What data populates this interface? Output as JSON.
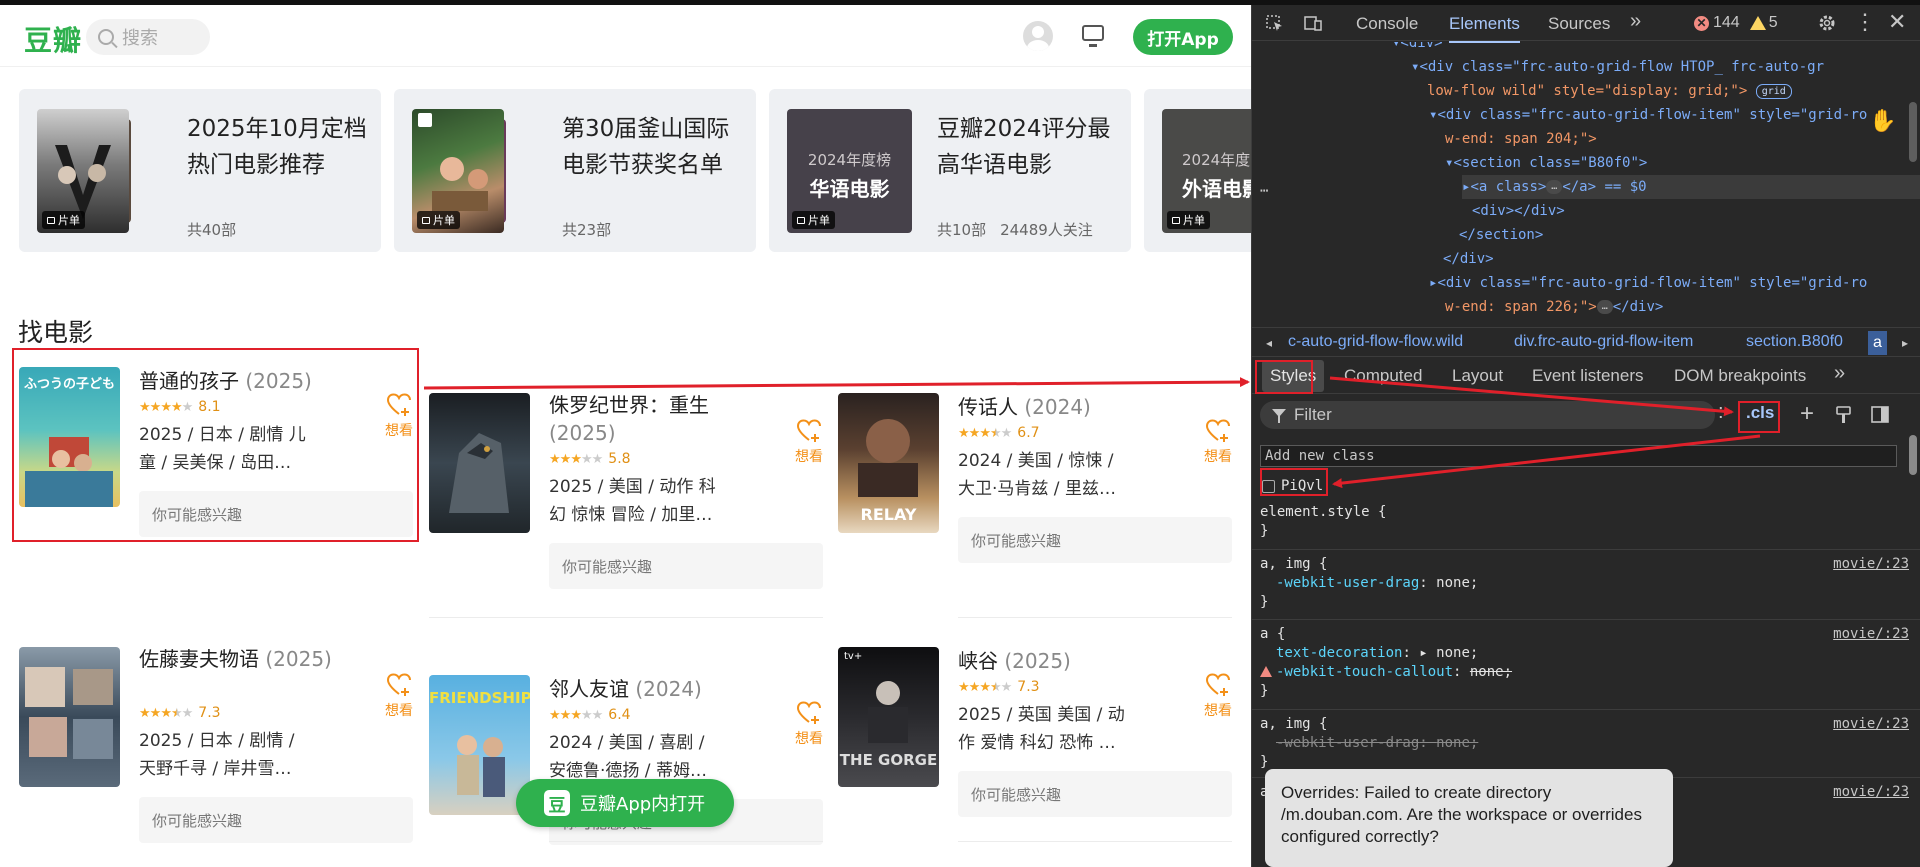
{
  "page": {
    "logo": "豆瓣",
    "search_placeholder": "搜索",
    "open_app": "打开App",
    "section_title": "找电影",
    "float_button": "豆瓣App内打开",
    "float_logo": "豆"
  },
  "doulists": [
    {
      "title": "2025年10月定档热门电影推荐",
      "count": "共40部",
      "followers": "",
      "tag": "片单",
      "cover_title": "",
      "cover_sub": ""
    },
    {
      "title": "第30届釜山国际电影节获奖名单",
      "count": "共23部",
      "followers": "",
      "tag": "片单",
      "cover_title": "",
      "cover_sub": ""
    },
    {
      "title": "豆瓣2024评分最高华语电影",
      "count": "共10部",
      "followers": "24489人关注",
      "tag": "片单",
      "cover_title": "华语电影",
      "cover_sub": "2024年度榜"
    },
    {
      "title": "",
      "count": "",
      "followers": "",
      "tag": "片单",
      "cover_title": "外语电影",
      "cover_sub": "2024年度"
    }
  ],
  "movies": [
    {
      "title": "普通的孩子",
      "year": "(2025)",
      "rating": "8.1",
      "stars": 4,
      "line1": "2025 / 日本 / 剧情 儿",
      "line2": "童 / 吴美保 / 岛田…",
      "maybe": "你可能感兴趣",
      "want": "想看"
    },
    {
      "title": "侏罗纪世界：重生",
      "year": "(2025)",
      "rating": "5.8",
      "stars": 3,
      "line1": "2025 / 美国 / 动作 科",
      "line2": "幻 惊悚 冒险 / 加里…",
      "maybe": "你可能感兴趣",
      "want": "想看"
    },
    {
      "title": "传话人",
      "year": "(2024)",
      "rating": "6.7",
      "stars": 3.5,
      "line1": "2024 / 美国 / 惊悚 /",
      "line2": "大卫·马肯兹 / 里兹…",
      "maybe": "你可能感兴趣",
      "want": "想看"
    },
    {
      "title": "佐藤妻夫物语",
      "year": "(2025)",
      "rating": "7.3",
      "stars": 3.5,
      "line1": "2025 / 日本 / 剧情 /",
      "line2": "天野千寻 / 岸井雪…",
      "maybe": "你可能感兴趣",
      "want": "想看"
    },
    {
      "title": "邻人友谊",
      "year": "(2024)",
      "rating": "6.4",
      "stars": 3,
      "line1": "2024 / 美国 / 喜剧 /",
      "line2": "安德鲁·德扬 / 蒂姆…",
      "maybe": "你可能感兴趣",
      "want": "想看"
    },
    {
      "title": "峡谷",
      "year": "(2025)",
      "rating": "7.3",
      "stars": 3.5,
      "line1": "2025 / 英国 美国 / 动",
      "line2": "作 爱情 科幻 恐怖 …",
      "maybe": "你可能感兴趣",
      "want": "想看"
    }
  ],
  "posters": {
    "m0": "ふつうの子ども",
    "m1": "",
    "m2": "RELAY",
    "m3": "",
    "m4": "FRIENDSHIP",
    "m5": "THE GORGE",
    "m5_badge": "tv+"
  },
  "devtools": {
    "tabs": [
      "Console",
      "Elements",
      "Sources"
    ],
    "more": "»",
    "errors": "144",
    "warnings": "5",
    "dom": [
      {
        "text": "<div class=\"frc-auto-grid-flow HTOP_ frc-auto-gr",
        "cont": "low-flow wild\" style=\"display: grid;\">",
        "pill": "grid"
      },
      {
        "text": "<div class=\"frc-auto-grid-flow-item\" style=\"grid-ro",
        "cont": "w-end: span 204;\">"
      },
      {
        "text": "<section class=\"B80f0\">"
      },
      {
        "text": "<a class>",
        "pill": "…",
        "tail": "</a> == $0"
      },
      {
        "text": "<div></div>"
      },
      {
        "text": "</section>"
      },
      {
        "text": "</div>"
      },
      {
        "text": "<div class=\"frc-auto-grid-flow-item\" style=\"grid-ro",
        "cont": "w-end: span 226;\">",
        "pill": "…",
        "tail": "</div>"
      },
      {
        "text": "<div>"
      }
    ],
    "breadcrumbs": [
      "c-auto-grid-flow-flow.wild",
      "div.frc-auto-grid-flow-item",
      "section.B80f0",
      "a"
    ],
    "subtabs": [
      "Styles",
      "Computed",
      "Layout",
      "Event listeners",
      "DOM breakpoints",
      "»"
    ],
    "filter": "Filter",
    "cls": ".cls",
    "add_class_placeholder": "Add new class",
    "class_checkbox": "PiQvl",
    "rules": [
      {
        "selector": "element.style {",
        "source": "",
        "props": []
      },
      {
        "selector": "a, img {",
        "source": "movie/:23",
        "props": [
          {
            "name": "-webkit-user-drag",
            "value": "none;",
            "struck": false,
            "warn": false
          }
        ]
      },
      {
        "selector": "a {",
        "source": "movie/:23",
        "props": [
          {
            "name": "text-decoration",
            "value": "▸ none;",
            "struck": false,
            "warn": false
          },
          {
            "name": "-webkit-touch-callout",
            "value": "none;",
            "struck": false,
            "warn": true,
            "value_struck": true
          }
        ]
      },
      {
        "selector": "a, img {",
        "source": "movie/:23",
        "props": [
          {
            "name": "-webkit-user-drag",
            "value": "none;",
            "struck": true,
            "warn": false
          }
        ]
      },
      {
        "selector": "a {",
        "source": "movie/:23",
        "props": []
      }
    ],
    "toast": "Overrides: Failed to create directory /m.douban.com. Are the workspace or overrides configured correctly?"
  },
  "colors": {
    "brand": "#2fb14e",
    "annotation": "#e0202a",
    "star": "#f5a623",
    "want": "#f39018"
  }
}
